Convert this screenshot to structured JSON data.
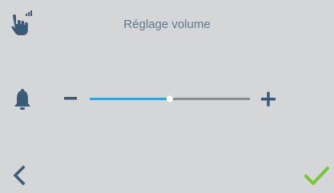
{
  "header": {
    "title": "Réglage volume",
    "touch_icon": "touch-hand-icon"
  },
  "volume": {
    "icon": "bell-icon",
    "minus_icon": "minus-icon",
    "plus_icon": "plus-icon",
    "level_fraction": 0.5
  },
  "footer": {
    "back_icon": "chevron-left-icon",
    "confirm_icon": "checkmark-icon"
  },
  "colors": {
    "background": "#d5d6d8",
    "icon": "#3b5a78",
    "title": "#5e7891",
    "slider_active": "#3aa0d8",
    "slider_track": "#8a8c8e",
    "slider_thumb": "#ffffff",
    "confirm": "#7cc33c"
  }
}
